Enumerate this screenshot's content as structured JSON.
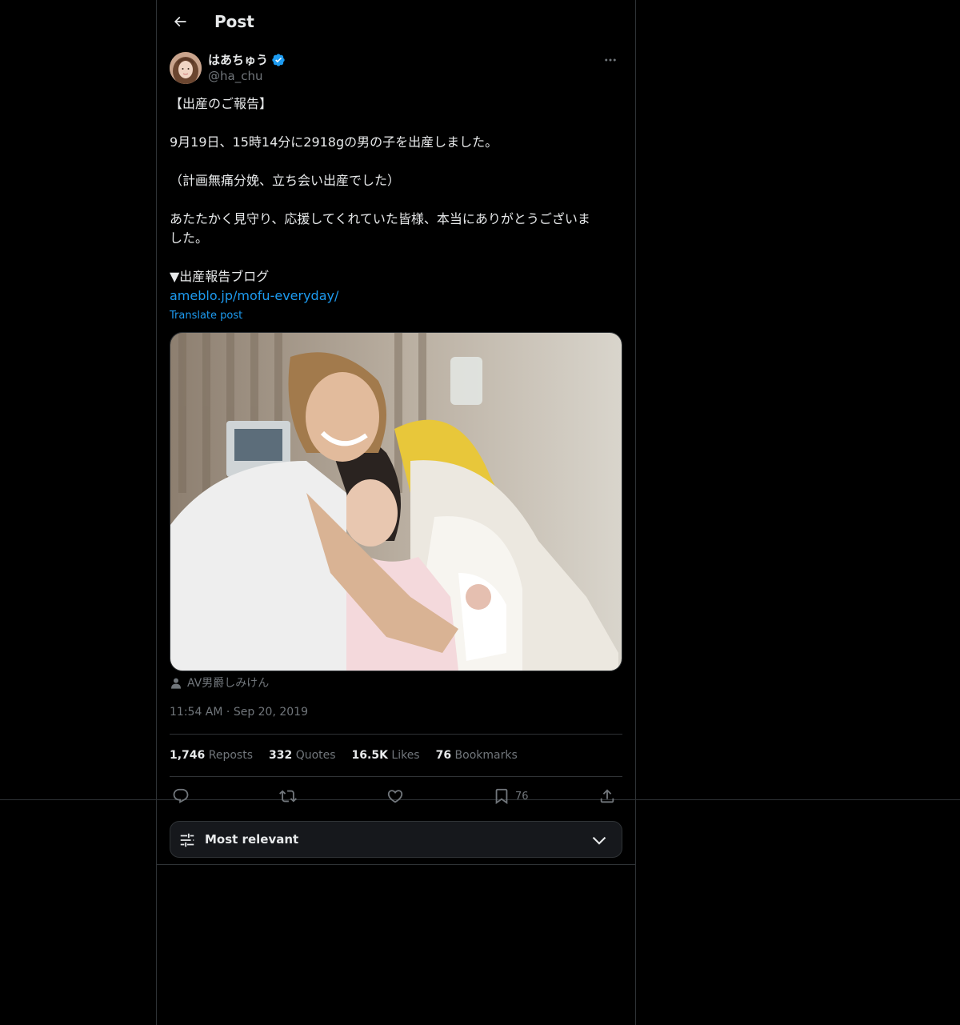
{
  "header": {
    "title": "Post",
    "back_icon": "arrow-left-icon"
  },
  "author": {
    "display_name": "はあちゅう",
    "handle": "@ha_chu",
    "verified": true,
    "verified_color": "#1d9bf0"
  },
  "tweet": {
    "lines": [
      "【出産のご報告】",
      "",
      "9月19日、15時14分に2918gの男の子を出産しました。",
      "",
      "（計画無痛分娩、立ち会い出産でした）",
      "",
      "あたたかく見守り、応援してくれていた皆様、本当にありがとうございま",
      "した。",
      "",
      "▼出産報告ブログ"
    ],
    "link": "ameblo.jp/mofu-everyday/",
    "translate_label": "Translate post"
  },
  "media": {
    "tagged_user": "AV男爵しみけん"
  },
  "meta": {
    "time": "11:54 AM",
    "separator": "·",
    "date": "Sep 20, 2019"
  },
  "stats": [
    {
      "num": "1,746",
      "label": "Reposts"
    },
    {
      "num": "332",
      "label": "Quotes"
    },
    {
      "num": "16.5K",
      "label": "Likes"
    },
    {
      "num": "76",
      "label": "Bookmarks"
    }
  ],
  "actions": {
    "bookmark_count": "76"
  },
  "sort": {
    "label": "Most relevant"
  },
  "colors": {
    "background": "#000000",
    "text": "#e7e9ea",
    "secondary": "#71767b",
    "accent": "#1d9bf0",
    "border": "#2f3336"
  }
}
